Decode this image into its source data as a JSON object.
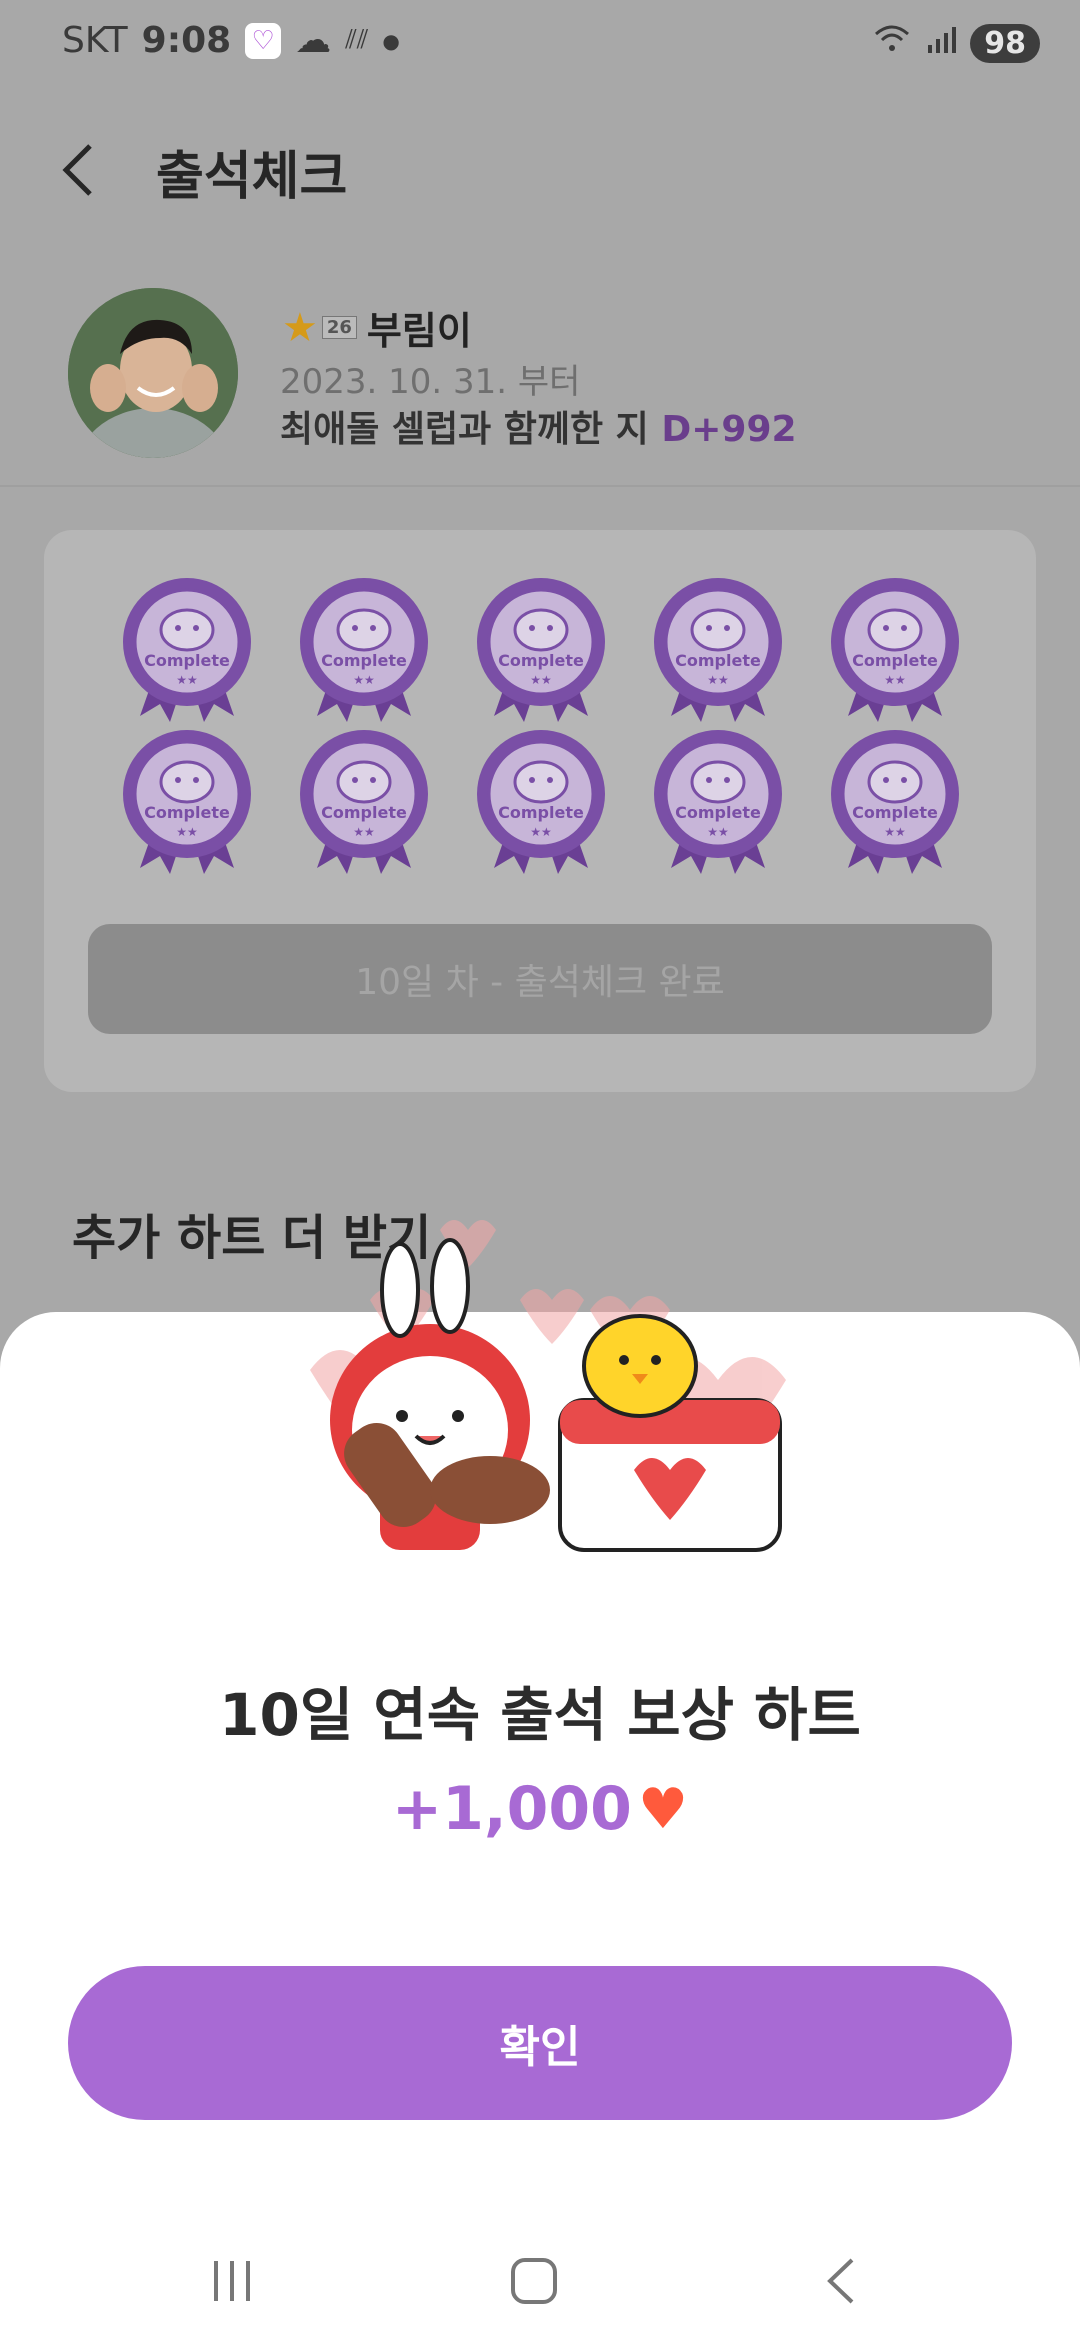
{
  "status": {
    "carrier": "SKT",
    "time": "9:08",
    "battery": "98",
    "icons": [
      "heart-app-icon",
      "cloud-icon",
      "signal-stripes-icon",
      "dot-icon",
      "wifi-icon",
      "cell-signal-icon"
    ]
  },
  "header": {
    "title": "출석체크",
    "back_icon": "chevron-left-icon"
  },
  "profile": {
    "name": "부림이",
    "level": "26",
    "since": "2023. 10. 31. 부터",
    "days_text": "최애돌 셀럽과 함께한 지",
    "days_count": "D+992"
  },
  "attendance": {
    "badge_label": "Complete",
    "badge_count": 10,
    "status_button": "10일 차 - 출석체크 완료"
  },
  "extra": {
    "title": "추가 하트 더 받기"
  },
  "modal": {
    "title": "10일 연속 출석 보상 하트",
    "reward": "+1,000",
    "reward_icon": "heart-icon",
    "confirm": "확인"
  },
  "navbar": {
    "icons": [
      "recent-apps-icon",
      "home-icon",
      "back-icon"
    ]
  },
  "colors": {
    "accent": "#a86ad4",
    "badge": "#7a4fa6",
    "overlay": "#a8a8a8"
  }
}
